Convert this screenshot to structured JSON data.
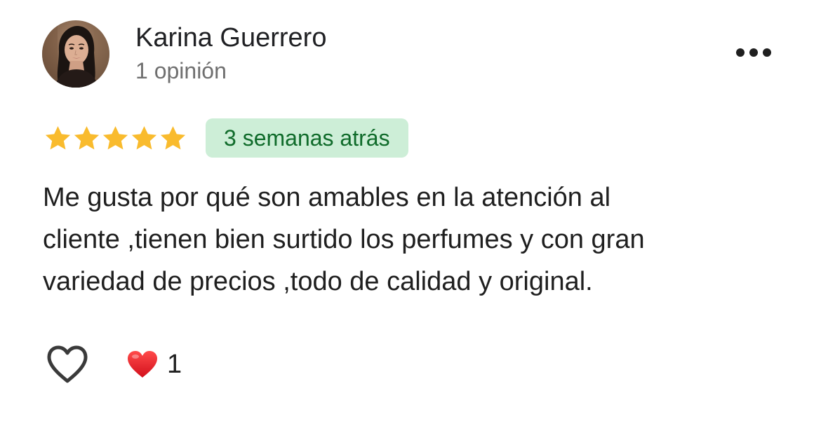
{
  "review": {
    "author": {
      "name": "Karina Guerrero",
      "meta": "1 opinión",
      "avatar_icon": "profile-photo"
    },
    "rating": {
      "value": 5,
      "max": 5,
      "star_color": "#f9bb2d"
    },
    "date_badge": {
      "label": "3 semanas atrás",
      "background": "#cdeed7",
      "text_color": "#0f6b2a"
    },
    "text_lines": [
      "Me gusta por qué son amables en la atención al",
      "cliente ,tienen bien surtido los perfumes y con gran",
      "variedad de precios ,todo de calidad y original."
    ],
    "actions": {
      "like_icon": "heart-outline-icon",
      "more_icon": "more-horizontal-icon"
    },
    "reactions": {
      "icon": "red-heart-icon",
      "count": "1",
      "color": "#e11d2a"
    }
  }
}
